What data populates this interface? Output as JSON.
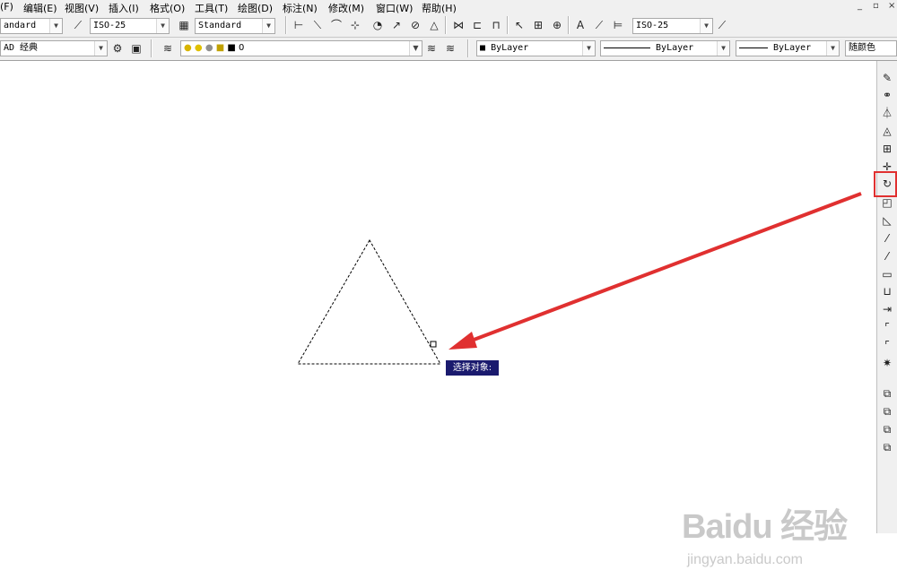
{
  "menu": {
    "items": [
      "(F)",
      "编辑(E)",
      "视图(V)",
      "插入(I)",
      "格式(O)",
      "工具(T)",
      "绘图(D)",
      "标注(N)",
      "修改(M)",
      "窗口(W)",
      "帮助(H)"
    ],
    "window_controls": [
      "_",
      "▫",
      "×"
    ]
  },
  "toolbar1": {
    "text_style": "andard",
    "dim_style": "ISO-25",
    "table_style": "Standard",
    "dim_style_right": "ISO-25"
  },
  "toolbar2": {
    "workspace": "AD 经典",
    "layer": "0",
    "color": "ByLayer",
    "linetype": "ByLayer",
    "lineweight": "ByLayer",
    "plotstyle": "随颜色"
  },
  "canvas": {
    "prompt_tooltip": "选择对象:",
    "annotation_color": "#e03030"
  },
  "right_toolbar": {
    "icons": [
      "erase-icon",
      "copy-icon",
      "mirror-icon",
      "offset-icon",
      "array-icon",
      "move-icon",
      "rotate-icon",
      "scale-icon",
      "stretch-icon",
      "trim-icon",
      "extend-icon",
      "break-at-point-icon",
      "break-icon",
      "join-icon",
      "chamfer-icon",
      "fillet-icon",
      "explode-icon",
      "draworder-front-icon",
      "draworder-back-icon",
      "draworder-above-icon",
      "draworder-under-icon"
    ],
    "highlighted": "rotate-icon"
  },
  "watermark": {
    "brand": "Baidu 经验",
    "url": "jingyan.baidu.com"
  }
}
